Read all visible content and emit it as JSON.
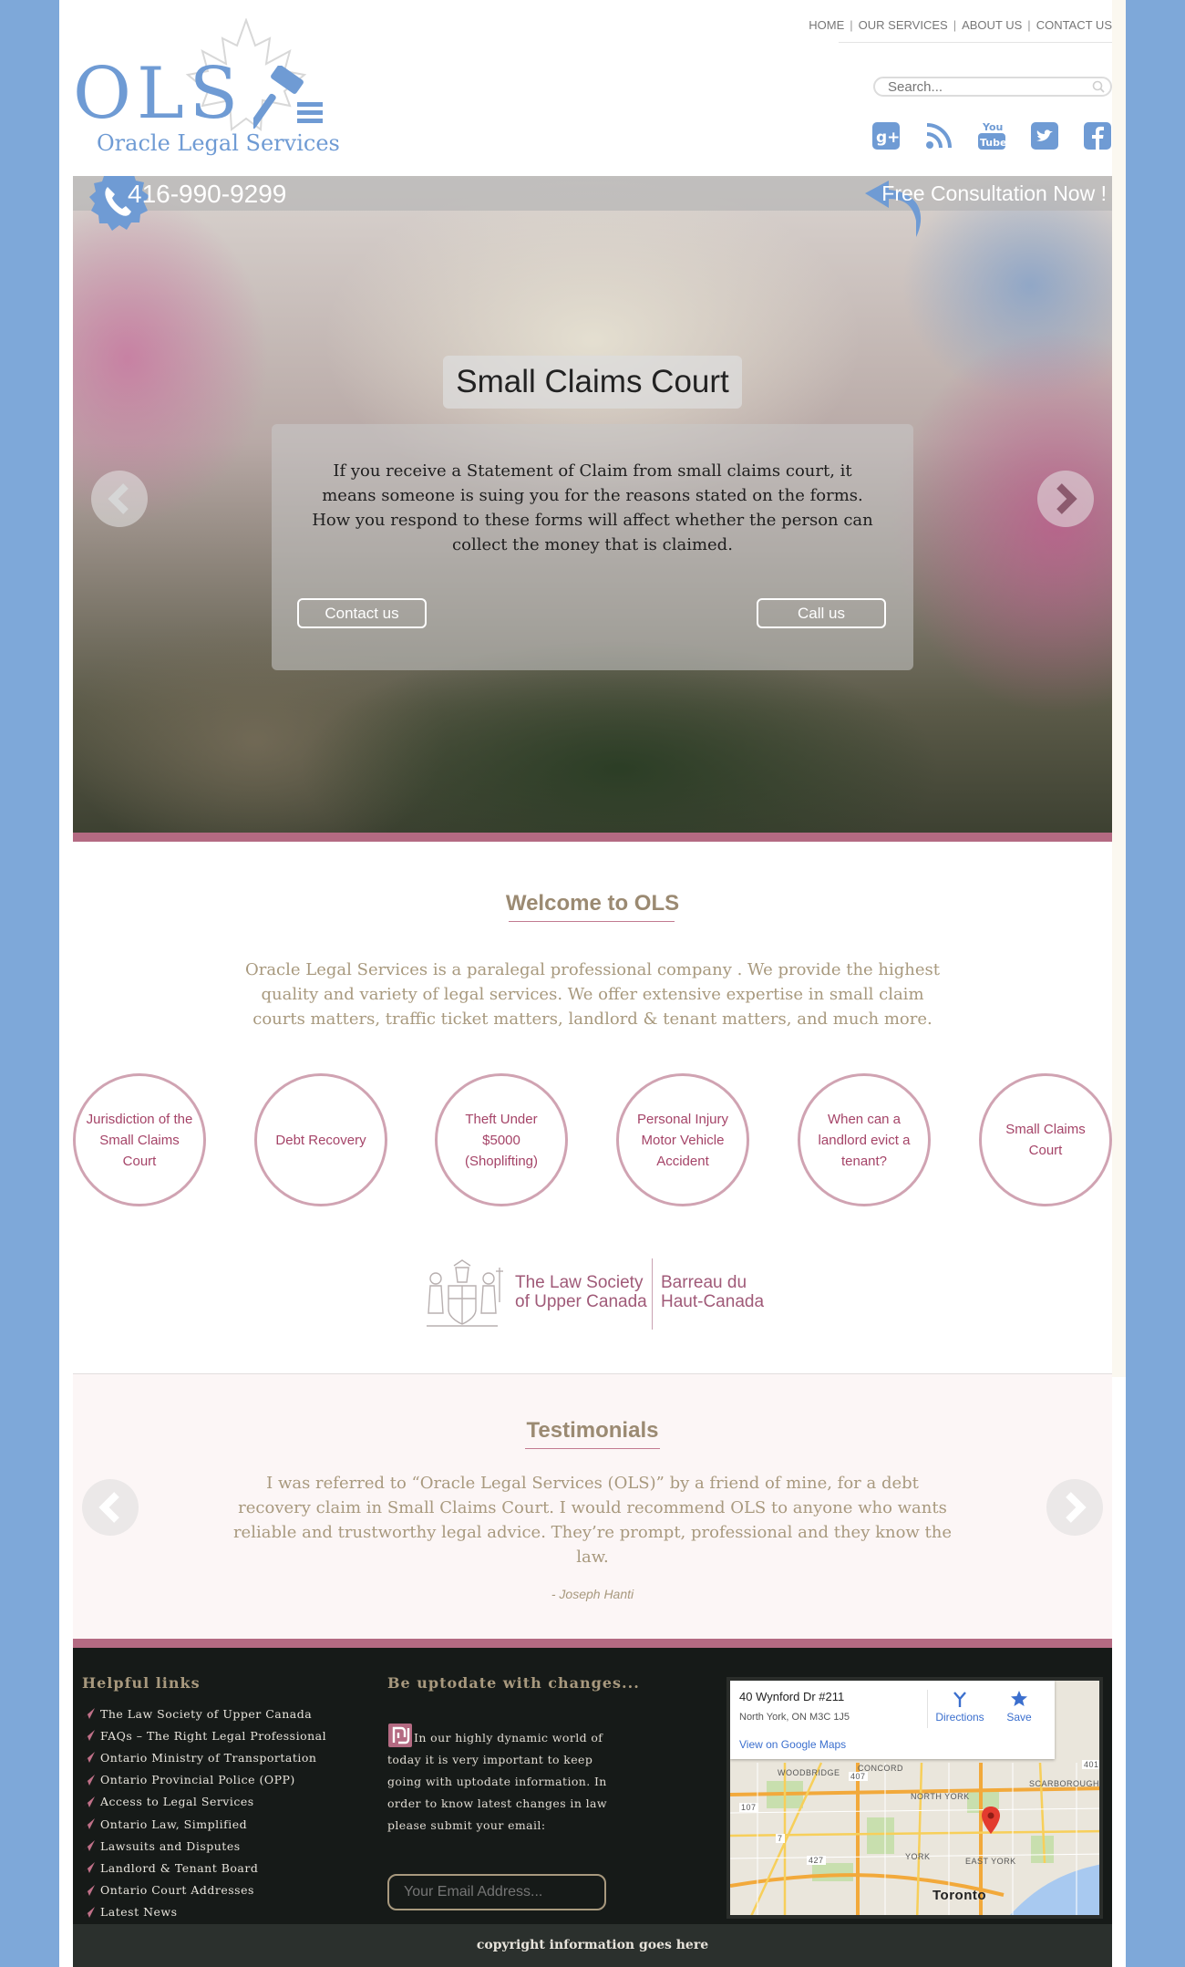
{
  "header": {
    "nav": [
      "HOME",
      "OUR SERVICES",
      "ABOUT US",
      "CONTACT US"
    ],
    "search_placeholder": "Search...",
    "logo_text": "OLS",
    "logo_subtitle": "Oracle Legal Services",
    "social": [
      "google-plus-icon",
      "rss-icon",
      "youtube-icon",
      "twitter-icon",
      "facebook-icon"
    ]
  },
  "hero": {
    "phone": "416-990-9299",
    "consultation": "Free Consultation Now !",
    "slide_title": "Small Claims Court",
    "slide_text": "If you receive a Statement of Claim from small claims court, it means someone is suing you for the reasons stated on the forms. How you respond to these forms will affect whether the person can collect the money that is claimed.",
    "contact_btn": "Contact us",
    "call_btn": "Call us"
  },
  "welcome": {
    "title": "Welcome to OLS",
    "text": "Oracle Legal Services is a paralegal professional company . We provide the highest quality and variety of legal services. We offer extensive expertise in small claim courts matters, traffic ticket matters, landlord & tenant matters, and much more."
  },
  "services": [
    "Jurisdiction of the Small Claims Court",
    "Debt Recovery",
    "Theft Under $5000 (Shoplifting)",
    "Personal Injury Motor Vehicle Accident",
    "When can a landlord evict a tenant?",
    "Small Claims Court"
  ],
  "law_society": {
    "en_line1": "The Law Society",
    "en_line2": "of Upper Canada",
    "fr_line1": "Barreau du",
    "fr_line2": "Haut-Canada"
  },
  "testimonials": {
    "title": "Testimonials",
    "quote": "I was referred to “Oracle Legal Services (OLS)” by a friend of mine, for a debt recovery claim in Small Claims Court. I would recommend OLS to anyone who wants reliable and trustworthy legal advice. They’re prompt, professional and they know the law.",
    "author": "- Joseph Hanti"
  },
  "footer": {
    "links_title": "Helpful links",
    "links": [
      "The Law Society of Upper Canada",
      "FAQs – The Right Legal Professional",
      "Ontario Ministry of Transportation",
      "Ontario Provincial Police (OPP)",
      "Access to Legal Services",
      "Ontario Law, Simplified",
      "Lawsuits and Disputes",
      "Landlord & Tenant Board",
      "Ontario Court Addresses",
      "Latest News"
    ],
    "update_title": "Be uptodate with changes...",
    "update_text": "In our highly dynamic world of today it is very important to keep going with uptodate information. In order to know latest changes in law please submit your email:",
    "email_placeholder": "Your Email Address...",
    "map": {
      "address": "40 Wynford Dr #211",
      "city": "North York, ON M3C 1J5",
      "view_link": "View on Google Maps",
      "directions": "Directions",
      "save": "Save",
      "labels": [
        "WOODBRIDGE",
        "CONCORD",
        "NORTH YORK",
        "SCARBOROUGH",
        "YORK",
        "EAST YORK",
        "Toronto",
        "407",
        "401",
        "107",
        "7",
        "427"
      ]
    },
    "copyright": "copyright information goes here"
  },
  "colors": {
    "background": "#7ea8d9",
    "brand_blue": "#6f9bd4",
    "accent_rose": "#b46a82",
    "text_tan": "#a8997e",
    "footer_dark": "#161a18"
  }
}
